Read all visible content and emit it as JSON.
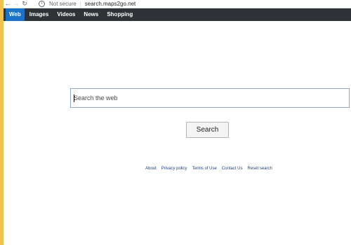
{
  "browser": {
    "back_icon": "arrow-left-icon",
    "forward_icon": "arrow-right-icon",
    "reload_icon": "reload-icon",
    "info_icon": "info-icon",
    "security_label": "Not secure",
    "url": "search.maps2go.net"
  },
  "navbar": {
    "items": [
      {
        "label": "Web",
        "active": true
      },
      {
        "label": "Images",
        "active": false
      },
      {
        "label": "Videos",
        "active": false
      },
      {
        "label": "News",
        "active": false
      },
      {
        "label": "Shopping",
        "active": false
      }
    ]
  },
  "search": {
    "placeholder": "Search the web",
    "value": "",
    "button_label": "Search"
  },
  "footer": {
    "links": [
      "About",
      "Privacy policy",
      "Terms of Use",
      "Contact Us",
      "Reset search"
    ]
  },
  "colors": {
    "navbar_bg": "#2f3337",
    "active_tab": "#1a73c8",
    "side_stripe": "#f0c24a",
    "link": "#1f3f7a"
  }
}
